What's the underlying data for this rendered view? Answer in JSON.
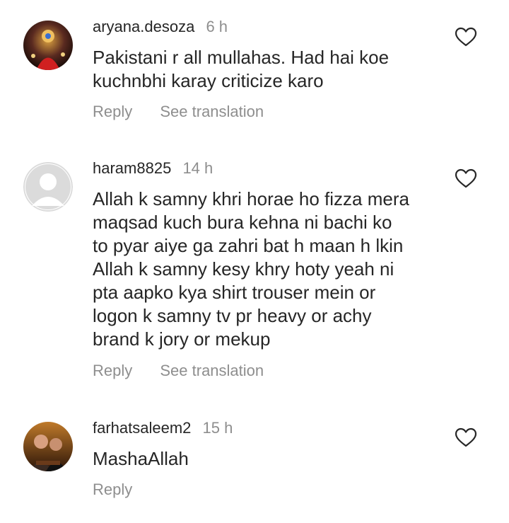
{
  "comments": [
    {
      "username": "aryana.desoza",
      "time": "6 h",
      "text": "Pakistani r all mullahas. Had hai koe\nkuchnbhi karay criticize karo",
      "reply_label": "Reply",
      "translate_label": "See translation",
      "like_icon": "heart-outline-icon"
    },
    {
      "username": "haram8825",
      "time": "14 h",
      "text": "Allah k samny khri horae ho fizza mera\nmaqsad kuch bura kehna ni bachi ko\nto pyar aiye ga zahri bat h maan h lkin\nAllah k samny kesy khry hoty yeah ni\npta aapko kya shirt trouser mein or\nlogon k samny tv pr heavy or achy\nbrand k jory or mekup",
      "reply_label": "Reply",
      "translate_label": "See translation",
      "like_icon": "heart-outline-icon"
    },
    {
      "username": "farhatsaleem2",
      "time": "15 h",
      "text": "MashaAllah",
      "reply_label": "Reply",
      "like_icon": "heart-outline-icon"
    }
  ],
  "colors": {
    "primary_text": "#262626",
    "secondary_text": "#8e8e8e",
    "default_avatar_bg": "#dbdbdb"
  }
}
